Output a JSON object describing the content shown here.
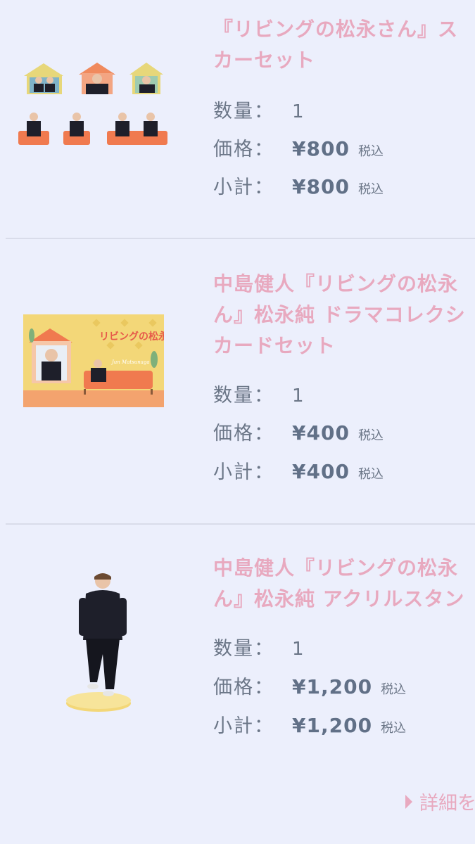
{
  "labels": {
    "quantity": "数量：",
    "price": "価格：",
    "subtotal": "小計：",
    "tax": "税込"
  },
  "items": [
    {
      "title_lines": [
        "『リビングの松永さん』ス",
        "カーセット"
      ],
      "quantity": "1",
      "price": "¥800",
      "subtotal": "¥800",
      "image": "sticker-set-image"
    },
    {
      "title_lines": [
        "中島健人『リビングの松永",
        "ん』松永純 ドラマコレクシ",
        "カードセット"
      ],
      "quantity": "1",
      "price": "¥400",
      "subtotal": "¥400",
      "image": "card-set-image",
      "card_logo": "リビングの松永さん",
      "card_name": "Jun Matsunaga"
    },
    {
      "title_lines": [
        "中島健人『リビングの松永",
        "ん』松永純 アクリルスタン"
      ],
      "quantity": "1",
      "price": "¥1,200",
      "subtotal": "¥1,200",
      "image": "acrylic-stand-image"
    }
  ],
  "footer": {
    "details_link": "詳細を"
  },
  "colors": {
    "background": "#eceffc",
    "accent": "#e8a9bf",
    "text": "#6b7687",
    "divider": "#d9dcea"
  }
}
